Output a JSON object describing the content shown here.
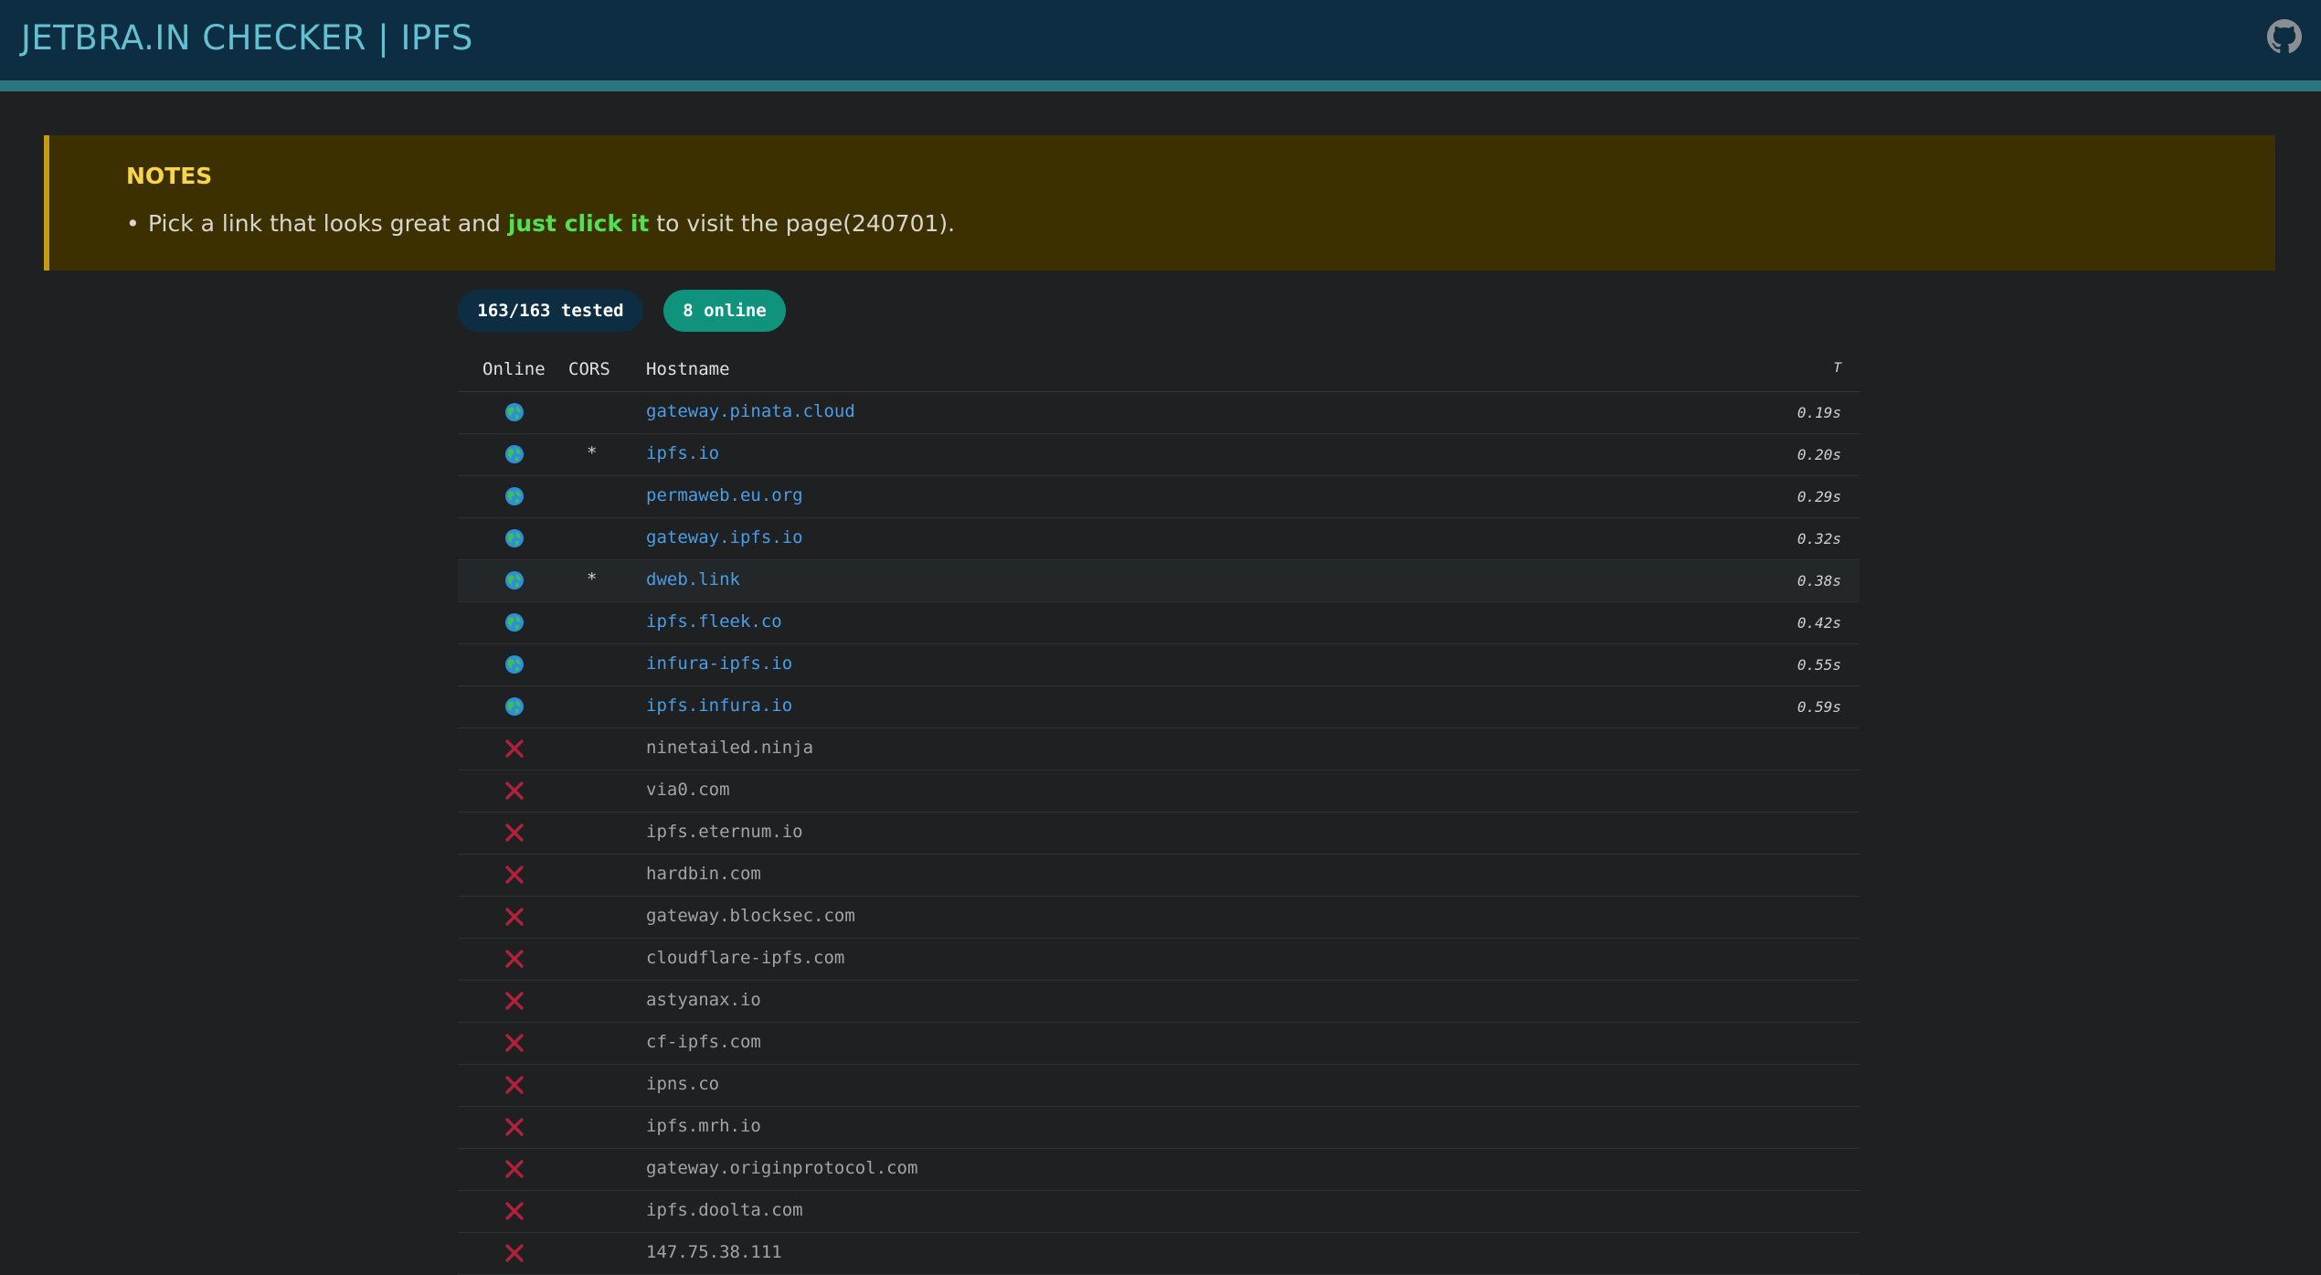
{
  "header": {
    "title": "JETBRA.IN CHECKER | IPFS",
    "github_icon": "github-icon"
  },
  "notes": {
    "title": "NOTES",
    "item_prefix": "Pick a link that looks great and ",
    "item_highlight": "just click it",
    "item_suffix": " to visit the page(240701)."
  },
  "badges": {
    "tested": "163/163 tested",
    "online": "8 online"
  },
  "table": {
    "columns": {
      "online": "Online",
      "cors": "CORS",
      "hostname": "Hostname",
      "time": "T"
    },
    "rows": [
      {
        "status": "online",
        "cors": "",
        "hostname": "gateway.pinata.cloud",
        "time": "0.19s"
      },
      {
        "status": "online",
        "cors": "*",
        "hostname": "ipfs.io",
        "time": "0.20s"
      },
      {
        "status": "online",
        "cors": "",
        "hostname": "permaweb.eu.org",
        "time": "0.29s"
      },
      {
        "status": "online",
        "cors": "",
        "hostname": "gateway.ipfs.io",
        "time": "0.32s"
      },
      {
        "status": "online",
        "cors": "*",
        "hostname": "dweb.link",
        "time": "0.38s",
        "hover": true
      },
      {
        "status": "online",
        "cors": "",
        "hostname": "ipfs.fleek.co",
        "time": "0.42s"
      },
      {
        "status": "online",
        "cors": "",
        "hostname": "infura-ipfs.io",
        "time": "0.55s"
      },
      {
        "status": "online",
        "cors": "",
        "hostname": "ipfs.infura.io",
        "time": "0.59s"
      },
      {
        "status": "offline",
        "cors": "",
        "hostname": "ninetailed.ninja",
        "time": ""
      },
      {
        "status": "offline",
        "cors": "",
        "hostname": "via0.com",
        "time": ""
      },
      {
        "status": "offline",
        "cors": "",
        "hostname": "ipfs.eternum.io",
        "time": ""
      },
      {
        "status": "offline",
        "cors": "",
        "hostname": "hardbin.com",
        "time": ""
      },
      {
        "status": "offline",
        "cors": "",
        "hostname": "gateway.blocksec.com",
        "time": ""
      },
      {
        "status": "offline",
        "cors": "",
        "hostname": "cloudflare-ipfs.com",
        "time": ""
      },
      {
        "status": "offline",
        "cors": "",
        "hostname": "astyanax.io",
        "time": ""
      },
      {
        "status": "offline",
        "cors": "",
        "hostname": "cf-ipfs.com",
        "time": ""
      },
      {
        "status": "offline",
        "cors": "",
        "hostname": "ipns.co",
        "time": ""
      },
      {
        "status": "offline",
        "cors": "",
        "hostname": "ipfs.mrh.io",
        "time": ""
      },
      {
        "status": "offline",
        "cors": "",
        "hostname": "gateway.originprotocol.com",
        "time": ""
      },
      {
        "status": "offline",
        "cors": "",
        "hostname": "ipfs.doolta.com",
        "time": ""
      },
      {
        "status": "offline",
        "cors": "",
        "hostname": "147.75.38.111",
        "time": ""
      }
    ]
  },
  "colors": {
    "online_link": "#4a9ee8",
    "offline_text": "#a4a4a4",
    "offline_x": "#b0223c",
    "online_badge": "#10937c",
    "header_bg": "#0c2d42",
    "notes_bg": "#3c3000",
    "highlight": "#52e052"
  }
}
